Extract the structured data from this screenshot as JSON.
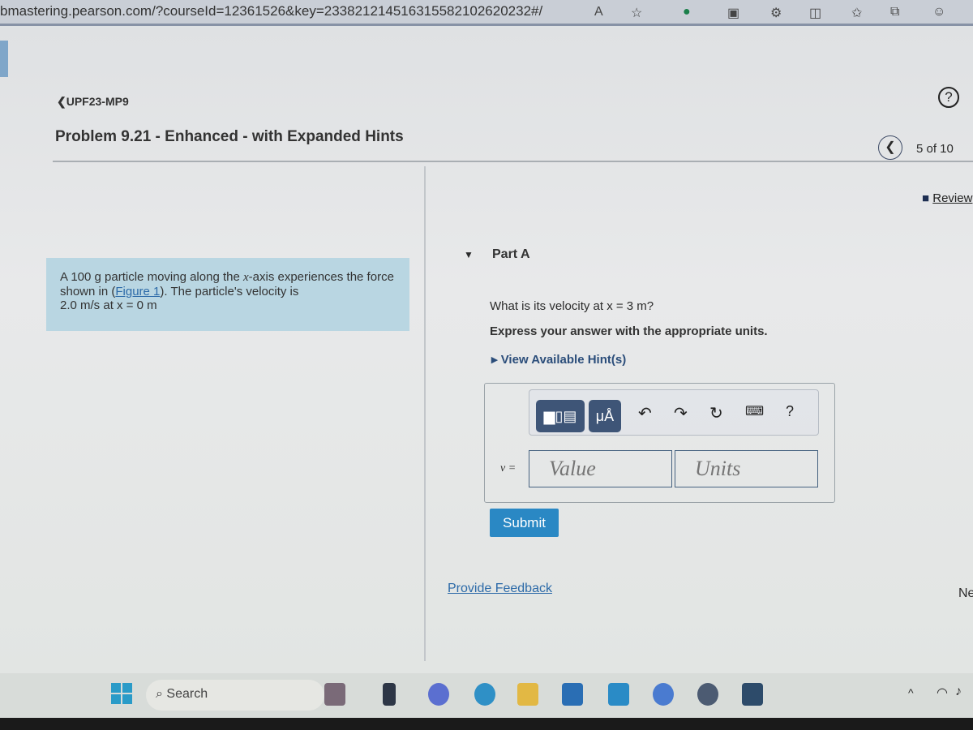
{
  "browser": {
    "url": "bmastering.pearson.com/?courseId=12361526&key=233821214516315582102620232#/"
  },
  "header": {
    "breadcrumb": "UPF23-MP9",
    "title": "Problem 9.21 - Enhanced - with Expanded Hints",
    "help": "?",
    "counter": "5 of 10",
    "review": "Review",
    "next": "Ne"
  },
  "problem": {
    "text_1": "A 100 g particle moving along the ",
    "var_x": "x",
    "text_2": "-axis experiences the force shown in (",
    "figure_link": "Figure 1",
    "text_3": "). The particle's velocity is ",
    "value": "2.0 m/s at x = 0 m"
  },
  "part": {
    "label": "Part A",
    "question": "What is its velocity at x = 3 m?",
    "instruction": "Express your answer with the appropriate units.",
    "hints": "View Available Hint(s)",
    "toolbar": {
      "units_button": "μÅ",
      "help": "?"
    },
    "answer": {
      "label": "v =",
      "value_placeholder": "Value",
      "units_placeholder": "Units"
    },
    "submit": "Submit"
  },
  "feedback": "Provide Feedback",
  "taskbar": {
    "search": "Search"
  }
}
